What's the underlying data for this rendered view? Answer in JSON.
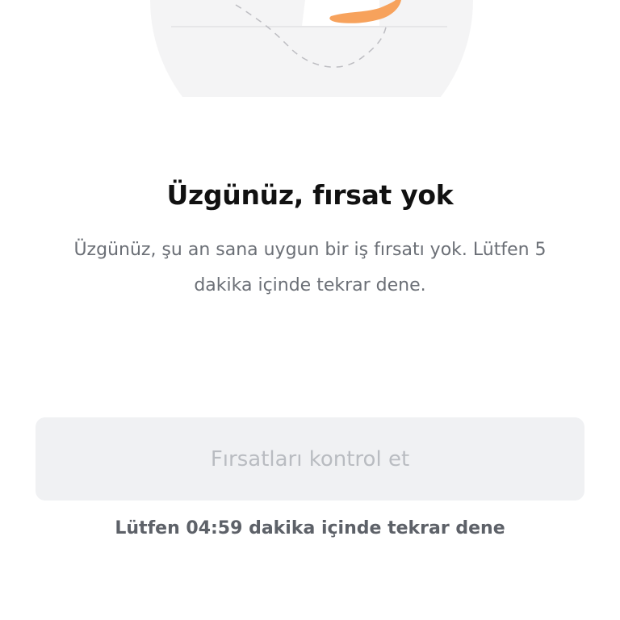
{
  "empty_state": {
    "title": "Üzgünüz, fırsat yok",
    "message": "Üzgünüz, şu an sana uygun bir iş fırsatı yok. Lütfen 5 dakika içinde tekrar dene."
  },
  "actions": {
    "check_opportunities_label": "Fırsatları kontrol et",
    "check_opportunities_disabled": true
  },
  "retry_notice": "Lütfen 04:59 dakika içinde tekrar dene",
  "colors": {
    "title": "#111111",
    "body_text": "#6b6f76",
    "button_bg_disabled": "#f0f1f3",
    "button_text_disabled": "#b9bcc1",
    "accent_orange": "#f7a25c"
  }
}
